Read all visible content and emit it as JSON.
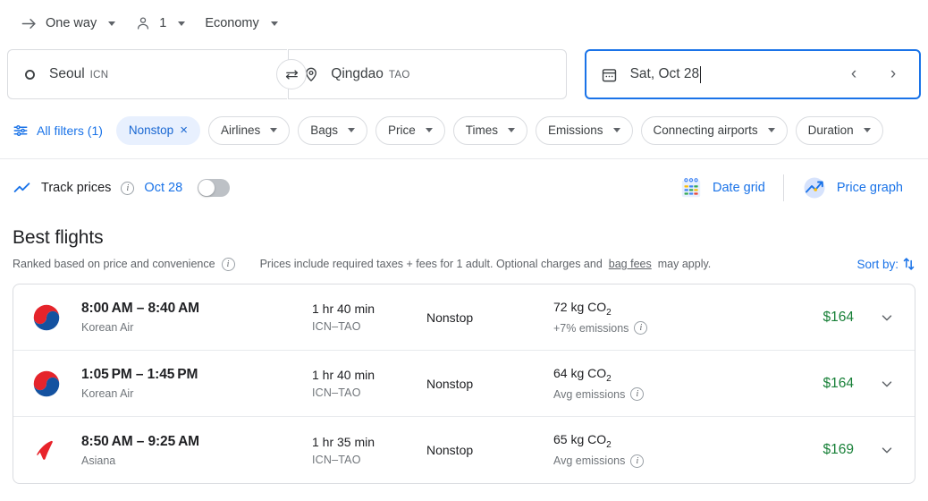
{
  "trip_options": [
    {
      "id": "trip-type",
      "icon": "arrow-right-icon",
      "label": "One way"
    },
    {
      "id": "passengers",
      "icon": "person-icon",
      "label": "1"
    },
    {
      "id": "cabin-class",
      "icon": "",
      "label": "Economy"
    }
  ],
  "search": {
    "origin": {
      "city": "Seoul",
      "code": "ICN",
      "icon": "circle-icon"
    },
    "destination": {
      "city": "Qingdao",
      "code": "TAO",
      "icon": "location-pin-icon"
    },
    "swap_icon": "swap-arrows-icon",
    "date": {
      "value": "Sat, Oct 28",
      "icon": "calendar-icon",
      "prev": "‹",
      "next": "›"
    }
  },
  "filters": {
    "all_filters_label": "All filters (1)",
    "all_filters_icon": "tune-icon",
    "chips": [
      {
        "label": "Nonstop",
        "active": true,
        "close": "×"
      },
      {
        "label": "Airlines",
        "active": false
      },
      {
        "label": "Bags",
        "active": false
      },
      {
        "label": "Price",
        "active": false
      },
      {
        "label": "Times",
        "active": false
      },
      {
        "label": "Emissions",
        "active": false
      },
      {
        "label": "Connecting airports",
        "active": false
      },
      {
        "label": "Duration",
        "active": false
      }
    ]
  },
  "track_prices": {
    "icon": "trending-up-icon",
    "label": "Track prices",
    "info_icon": "info-icon",
    "date": "Oct 28",
    "toggle_on": false
  },
  "view_buttons": {
    "date_grid": {
      "label": "Date grid",
      "icon": "date-grid-icon"
    },
    "price_graph": {
      "label": "Price graph",
      "icon": "price-graph-icon"
    }
  },
  "best_flights": {
    "title": "Best flights",
    "ranked_note": "Ranked based on price and convenience",
    "info_icon": "info-icon",
    "prices_note_before": "Prices include required taxes + fees for 1 adult. Optional charges and",
    "bag_fees_link": "bag fees",
    "prices_note_after": "may apply.",
    "sort_by_label": "Sort by:",
    "sort_icon": "sort-arrows-icon"
  },
  "flights": [
    {
      "logo": "korean-air-logo",
      "times": "8:00 AM – 8:40 AM",
      "airline": "Korean Air",
      "duration": "1 hr 40 min",
      "route": "ICN–TAO",
      "stops": "Nonstop",
      "emissions": "72 kg CO",
      "emissions_sub": "2",
      "emissions_note": "+7% emissions",
      "price": "$164",
      "expand_icon": "chevron-down-icon"
    },
    {
      "logo": "korean-air-logo",
      "times": "1:05 PM – 1:45 PM",
      "airline": "Korean Air",
      "duration": "1 hr 40 min",
      "route": "ICN–TAO",
      "stops": "Nonstop",
      "emissions": "64 kg CO",
      "emissions_sub": "2",
      "emissions_note": "Avg emissions",
      "price": "$164",
      "expand_icon": "chevron-down-icon"
    },
    {
      "logo": "asiana-logo",
      "times": "8:50 AM – 9:25 AM",
      "airline": "Asiana",
      "duration": "1 hr 35 min",
      "route": "ICN–TAO",
      "stops": "Nonstop",
      "emissions": "65 kg CO",
      "emissions_sub": "2",
      "emissions_note": "Avg emissions",
      "price": "$169",
      "expand_icon": "chevron-down-icon"
    }
  ],
  "colors": {
    "accent_blue": "#1a73e8",
    "chip_active_bg": "#e8f0fe",
    "price_green": "#188038",
    "border": "#dadce0",
    "text_primary": "#202124",
    "text_secondary": "#5f6368"
  }
}
